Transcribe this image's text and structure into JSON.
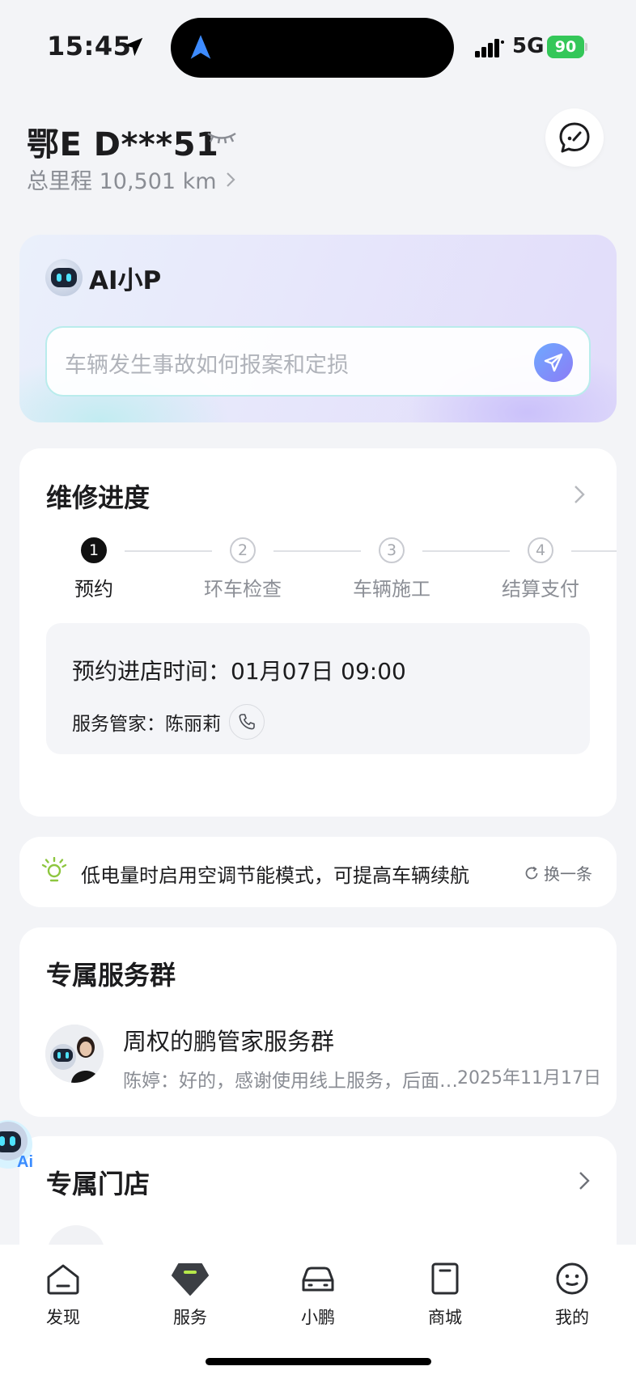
{
  "status_bar": {
    "time": "15:45",
    "network": "5G",
    "battery": "90"
  },
  "header": {
    "plate": "鄂E D***51",
    "mileage": "总里程 10,501 km"
  },
  "ai": {
    "title": "AI小P",
    "placeholder": "车辆发生事故如何报案和定损"
  },
  "repair": {
    "title": "维修进度",
    "steps": [
      {
        "num": "1",
        "label": "预约"
      },
      {
        "num": "2",
        "label": "环车检查"
      },
      {
        "num": "3",
        "label": "车辆施工"
      },
      {
        "num": "4",
        "label": "结算支付"
      }
    ],
    "appointment_time": "预约进店时间：01月07日  09:00",
    "staff": "服务管家：陈丽莉"
  },
  "tip": {
    "text": "低电量时启用空调节能模式，可提高车辆续航",
    "refresh_label": "换一条"
  },
  "group": {
    "title": "专属服务群",
    "name": "周权的鹏管家服务群",
    "last_message": "陈婷：好的，感谢使用线上服务，后面有其...",
    "date": "2025年11月17日"
  },
  "store": {
    "title": "专属门店"
  },
  "tabbar": [
    {
      "label": "发现",
      "icon": "discover-icon"
    },
    {
      "label": "服务",
      "icon": "service-icon"
    },
    {
      "label": "小鹏",
      "icon": "car-icon"
    },
    {
      "label": "商城",
      "icon": "mall-icon"
    },
    {
      "label": "我的",
      "icon": "profile-icon"
    }
  ],
  "colors": {
    "accent_green": "#34c759",
    "service_green": "#b6e84a",
    "send_blue": "#6ea9ff"
  }
}
